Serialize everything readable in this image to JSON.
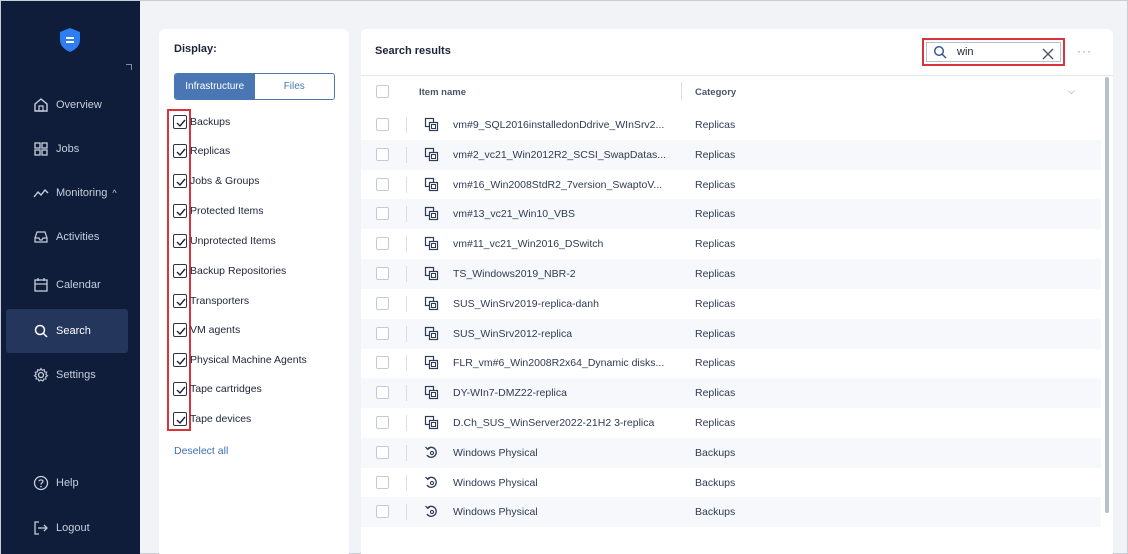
{
  "sidebar": {
    "items": [
      {
        "label": "Overview",
        "icon": "home-icon"
      },
      {
        "label": "Jobs",
        "icon": "grid-icon"
      },
      {
        "label": "Monitoring",
        "icon": "monitoring-icon"
      },
      {
        "label": "Activities",
        "icon": "inbox-icon"
      },
      {
        "label": "Calendar",
        "icon": "calendar-icon"
      },
      {
        "label": "Search",
        "icon": "search-icon"
      },
      {
        "label": "Settings",
        "icon": "gear-icon"
      },
      {
        "label": "Help",
        "icon": "help-icon"
      },
      {
        "label": "Logout",
        "icon": "logout-icon"
      }
    ],
    "monitoring_chevron": "^"
  },
  "filters": {
    "title": "Display:",
    "tabs": [
      "Infrastructure",
      "Files"
    ],
    "active_tab": "Infrastructure",
    "checkboxes": [
      {
        "label": "Backups",
        "checked": true
      },
      {
        "label": "Replicas",
        "checked": true
      },
      {
        "label": "Jobs & Groups",
        "checked": true
      },
      {
        "label": "Protected Items",
        "checked": true
      },
      {
        "label": "Unprotected Items",
        "checked": true
      },
      {
        "label": "Backup Repositories",
        "checked": true
      },
      {
        "label": "Transporters",
        "checked": true
      },
      {
        "label": "VM agents",
        "checked": true
      },
      {
        "label": "Physical Machine Agents",
        "checked": true
      },
      {
        "label": "Tape cartridges",
        "checked": true
      },
      {
        "label": "Tape devices",
        "checked": true
      }
    ],
    "deselect_label": "Deselect all"
  },
  "results": {
    "title": "Search results",
    "search": {
      "value": "win"
    },
    "more_label": "···",
    "columns": [
      "Item name",
      "Category"
    ],
    "rows": [
      {
        "name": "vm#9_SQL2016installedonDdrive_WInSrv2...",
        "category": "Replicas",
        "icon": "replica-icon"
      },
      {
        "name": "vm#2_vc21_Win2012R2_SCSI_SwapDatas...",
        "category": "Replicas",
        "icon": "replica-icon"
      },
      {
        "name": "vm#16_Win2008StdR2_7version_SwaptoV...",
        "category": "Replicas",
        "icon": "replica-icon"
      },
      {
        "name": "vm#13_vc21_Win10_VBS",
        "category": "Replicas",
        "icon": "replica-icon"
      },
      {
        "name": "vm#11_vc21_Win2016_DSwitch",
        "category": "Replicas",
        "icon": "replica-icon"
      },
      {
        "name": "TS_Windows2019_NBR-2",
        "category": "Replicas",
        "icon": "replica-icon"
      },
      {
        "name": "SUS_WinSrv2019-replica-danh",
        "category": "Replicas",
        "icon": "replica-icon"
      },
      {
        "name": "SUS_WinSrv2012-replica",
        "category": "Replicas",
        "icon": "replica-icon"
      },
      {
        "name": "FLR_vm#6_Win2008R2x64_Dynamic disks...",
        "category": "Replicas",
        "icon": "replica-icon"
      },
      {
        "name": "DY-WIn7-DMZ22-replica",
        "category": "Replicas",
        "icon": "replica-icon"
      },
      {
        "name": "D.Ch_SUS_WinServer2022-21H2 3-replica",
        "category": "Replicas",
        "icon": "replica-icon"
      },
      {
        "name": "Windows Physical",
        "category": "Backups",
        "icon": "backup-icon"
      },
      {
        "name": "Windows Physical",
        "category": "Backups",
        "icon": "backup-icon"
      },
      {
        "name": "Windows Physical",
        "category": "Backups",
        "icon": "backup-icon"
      }
    ]
  },
  "colors": {
    "sidebar_bg": "#0f1d3a",
    "accent": "#4a77b4",
    "highlight": "#d9343a"
  }
}
